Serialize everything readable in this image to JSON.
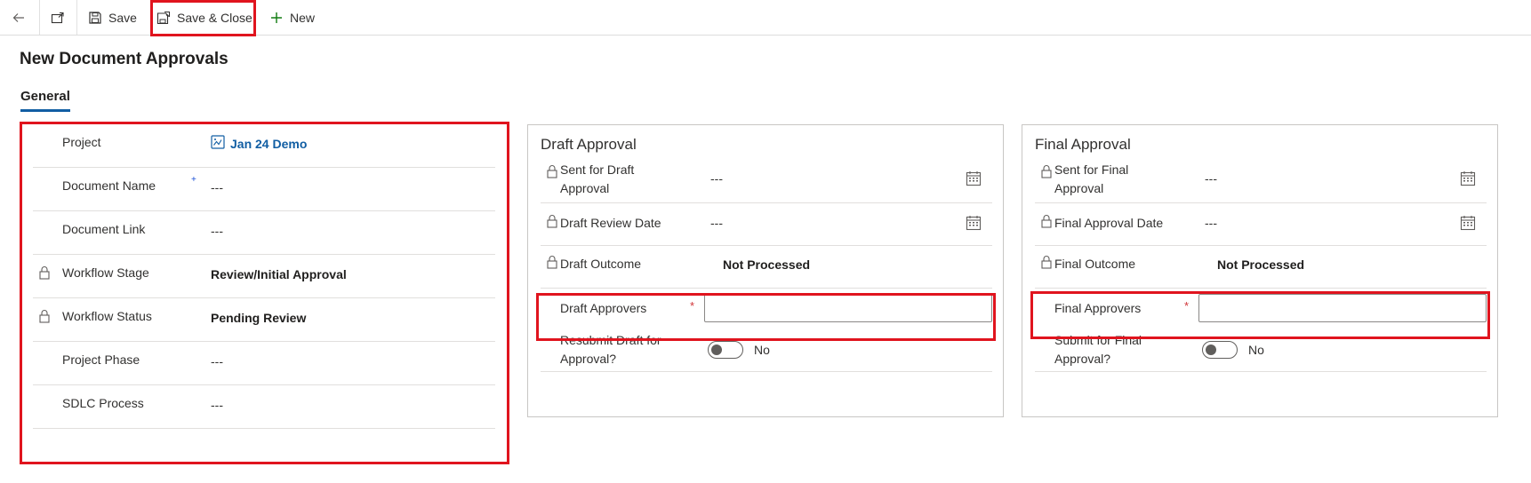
{
  "toolbar": {
    "save_label": "Save",
    "save_close_label": "Save & Close",
    "new_label": "New"
  },
  "page": {
    "title": "New Document Approvals",
    "tab_general": "General"
  },
  "general": {
    "project_label": "Project",
    "project_value": "Jan 24 Demo",
    "document_name_label": "Document Name",
    "document_name_required": "+",
    "document_name_value": "---",
    "document_link_label": "Document Link",
    "document_link_value": "---",
    "workflow_stage_label": "Workflow Stage",
    "workflow_stage_value": "Review/Initial Approval",
    "workflow_status_label": "Workflow Status",
    "workflow_status_value": "Pending Review",
    "project_phase_label": "Project Phase",
    "project_phase_value": "---",
    "sdlc_label": "SDLC Process",
    "sdlc_value": "---"
  },
  "draft": {
    "title": "Draft Approval",
    "sent_label_1": "Sent for Draft",
    "sent_label_2": "Approval",
    "sent_value": "---",
    "review_date_label": "Draft Review Date",
    "review_date_value": "---",
    "outcome_label": "Draft Outcome",
    "outcome_value": "Not Processed",
    "approvers_label": "Draft Approvers",
    "approvers_required": "*",
    "approvers_value": "",
    "resubmit_label_1": "Resubmit Draft for",
    "resubmit_label_2": "Approval?",
    "resubmit_value": "No"
  },
  "final": {
    "title": "Final Approval",
    "sent_label_1": "Sent for Final",
    "sent_label_2": "Approval",
    "sent_value": "---",
    "approval_date_label": "Final Approval Date",
    "approval_date_value": "---",
    "outcome_label": "Final Outcome",
    "outcome_value": "Not Processed",
    "approvers_label": "Final Approvers",
    "approvers_required": "*",
    "approvers_value": "",
    "submit_label_1": "Submit for Final",
    "submit_label_2": "Approval?",
    "submit_value": "No"
  },
  "colors": {
    "highlight": "#e0141e",
    "link": "#115ea3",
    "required": "#d13438",
    "tab_underline": "#115ea3"
  },
  "icons": [
    "back-arrow-icon",
    "popout-icon",
    "save-icon",
    "save-close-icon",
    "plus-icon",
    "project-entity-icon",
    "lock-icon",
    "calendar-icon"
  ]
}
